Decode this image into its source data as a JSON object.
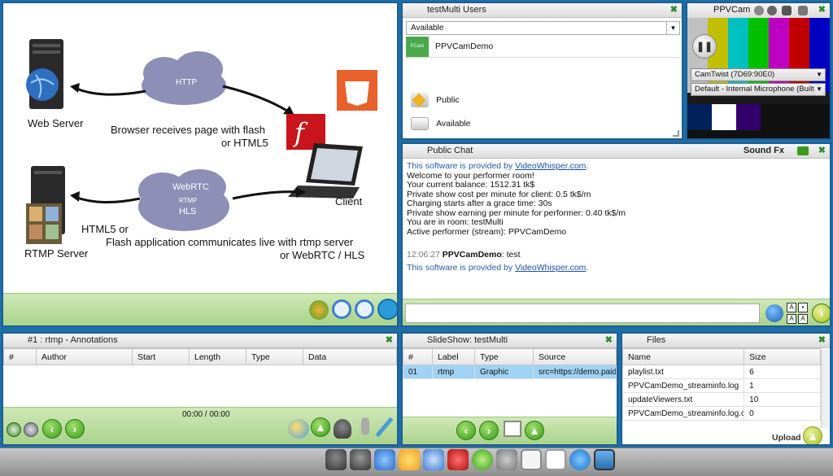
{
  "diagram": {
    "web_server": "Web Server",
    "http": "HTTP",
    "browser_text_1": "Browser receives page with flash",
    "browser_text_2": "or HTML5",
    "html5_badge": "HTML",
    "client": "Client",
    "webrtc": "WebRTC",
    "rtmp": "RTMP",
    "hls": "HLS",
    "html5_or": "HTML5 or",
    "flash_text_1": "Flash application communicates live with rtmp server",
    "flash_text_2": "or WebRTC / HLS",
    "rtmp_server": "RTMP Server"
  },
  "users": {
    "title": "testMulti Users",
    "status_select": "Available",
    "list": [
      {
        "name": "PPVCamDemo",
        "thumb_label": "PCam"
      }
    ],
    "status_options": [
      {
        "label": "Public"
      },
      {
        "label": "Available"
      }
    ]
  },
  "cam": {
    "title": "PPVCam",
    "camera_select": "CamTwist (7D69:90E0)",
    "mic_select": "Default - Internal Microphone (Built"
  },
  "chat": {
    "title": "Public Chat",
    "soundfx": "Sound Fx",
    "lines": [
      {
        "text": "This software is provided by ",
        "link": "VideoWhisper.com",
        "after": ".",
        "cls": "sysmsg"
      },
      {
        "text": "Welcome to your performer room!"
      },
      {
        "text": "Your current balance: 1512.31 tk$"
      },
      {
        "text": "Private show cost per minute for client: 0.5 tk$/m"
      },
      {
        "text": "Charging starts after a grace time: 30s"
      },
      {
        "text": "Private show earning per minute for performer: 0.40 tk$/m"
      },
      {
        "text": "You are in room: testMulti"
      },
      {
        "text": "Active performer (stream): PPVCamDemo"
      }
    ],
    "message": {
      "time": "12:06:27",
      "user": "PPVCamDemo",
      "text": ": test"
    },
    "footer": {
      "text": "This software is provided by ",
      "link": "VideoWhisper.com",
      "after": "."
    }
  },
  "annotations": {
    "title": "#1 : rtmp - Annotations",
    "columns": [
      "#",
      "Author",
      "Start",
      "Length",
      "Type",
      "Data"
    ],
    "time": "00:00 / 00:00"
  },
  "slideshow": {
    "title": "SlideShow: testMulti",
    "columns": [
      "#",
      "Label",
      "Type",
      "Source"
    ],
    "rows": [
      [
        "01",
        "rtmp",
        "Graphic",
        "src=https://demo.paidv"
      ]
    ]
  },
  "files": {
    "title": "Files",
    "columns": [
      "Name",
      "Size"
    ],
    "rows": [
      [
        "playlist.txt",
        "6"
      ],
      [
        "PPVCamDemo_streaminfo.log",
        "1"
      ],
      [
        "updateViewers.txt",
        "10"
      ],
      [
        "PPVCamDemo_streaminfo.log.cr",
        "0"
      ]
    ],
    "upload_label": "Upload"
  },
  "colors": {
    "panel_border": "#1b5f93",
    "background": "#1f6ea8",
    "green_bar": "#b6dc98",
    "selected_row": "#9fd3f5"
  }
}
